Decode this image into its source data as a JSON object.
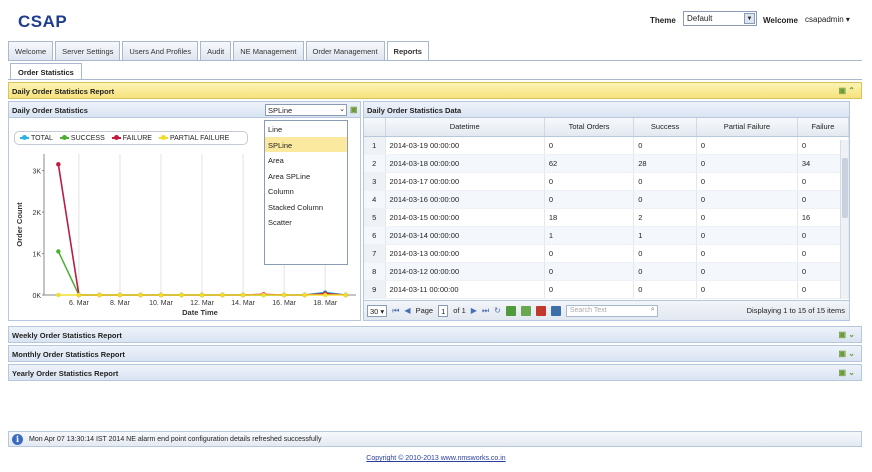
{
  "app": {
    "title": "CSAP"
  },
  "header": {
    "theme_label": "Theme",
    "theme_value": "Default",
    "welcome_label": "Welcome",
    "user": "csapadmin"
  },
  "tabs": [
    "Welcome",
    "Server Settings",
    "Users And Profiles",
    "Audit",
    "NE Management",
    "Order Management",
    "Reports"
  ],
  "active_tab": "Reports",
  "sub_tab": "Order Statistics",
  "sections": {
    "daily": "Daily Order Statistics Report",
    "weekly": "Weekly Order Statistics Report",
    "monthly": "Monthly Order Statistics Report",
    "yearly": "Yearly Order Statistics Report"
  },
  "chart_panel": {
    "title": "Daily Order Statistics",
    "chart_type_value": "SPLine",
    "chart_type_options": [
      "Line",
      "SPLine",
      "Area",
      "Area SPLine",
      "Column",
      "Stacked Column",
      "Scatter"
    ]
  },
  "chart_data": {
    "type": "line",
    "xlabel": "Date Time",
    "ylabel": "Order Count",
    "ylim": [
      0,
      3400
    ],
    "ytick_labels": [
      "0K",
      "1K",
      "2K",
      "3K"
    ],
    "yticks": [
      0,
      1000,
      2000,
      3000
    ],
    "x_tick_labels": [
      "6. Mar",
      "8. Mar",
      "10. Mar",
      "12. Mar",
      "14. Mar",
      "16. Mar",
      "18. Mar"
    ],
    "x_tick_days": [
      6,
      8,
      10,
      12,
      14,
      16,
      18
    ],
    "x_days": [
      5,
      6,
      7,
      8,
      9,
      10,
      11,
      12,
      13,
      14,
      15,
      16,
      17,
      18,
      19
    ],
    "xlim": [
      4.3,
      19.5
    ],
    "series": [
      {
        "name": "TOTAL",
        "color": "#2ab3e6",
        "values": [
          3150,
          0,
          0,
          0,
          0,
          0,
          0,
          0,
          0,
          0,
          0,
          0,
          0,
          62,
          0
        ]
      },
      {
        "name": "SUCCESS",
        "color": "#4caf34",
        "values": [
          1050,
          0,
          0,
          0,
          0,
          0,
          0,
          0,
          0,
          0,
          1,
          0,
          0,
          28,
          0
        ]
      },
      {
        "name": "FAILURE",
        "color": "#c8193c",
        "values": [
          3150,
          0,
          0,
          0,
          0,
          0,
          0,
          0,
          0,
          0,
          16,
          0,
          0,
          34,
          0
        ]
      },
      {
        "name": "PARTIAL FAILURE",
        "color": "#f2dd2b",
        "values": [
          0,
          0,
          0,
          0,
          0,
          0,
          0,
          0,
          0,
          0,
          0,
          0,
          0,
          0,
          0
        ]
      }
    ]
  },
  "data_panel": {
    "title": "Daily Order Statistics Data",
    "columns": [
      "Datetime",
      "Total Orders",
      "Success",
      "Partial Failure",
      "Failure"
    ],
    "rows": [
      [
        "1",
        "2014-03-19 00:00:00",
        "0",
        "0",
        "0",
        "0"
      ],
      [
        "2",
        "2014-03-18 00:00:00",
        "62",
        "28",
        "0",
        "34"
      ],
      [
        "3",
        "2014-03-17 00:00:00",
        "0",
        "0",
        "0",
        "0"
      ],
      [
        "4",
        "2014-03-16 00:00:00",
        "0",
        "0",
        "0",
        "0"
      ],
      [
        "5",
        "2014-03-15 00:00:00",
        "18",
        "2",
        "0",
        "16"
      ],
      [
        "6",
        "2014-03-14 00:00:00",
        "1",
        "1",
        "0",
        "0"
      ],
      [
        "7",
        "2014-03-13 00:00:00",
        "0",
        "0",
        "0",
        "0"
      ],
      [
        "8",
        "2014-03-12 00:00:00",
        "0",
        "0",
        "0",
        "0"
      ],
      [
        "9",
        "2014-03-11 00:00:00",
        "0",
        "0",
        "0",
        "0"
      ]
    ]
  },
  "pager": {
    "page_size": "30",
    "page_label": "Page",
    "page_value": "1",
    "of_label": "of 1",
    "search_placeholder": "Search Text",
    "info": "Displaying 1 to 15 of 15 items"
  },
  "status": {
    "message": "Mon Apr 07 13:30:14 IST 2014 NE alarm end point configuration details refreshed successfully"
  },
  "footer": {
    "copyright": "Copyright © 2010-2013 www.nmsworks.co.in"
  }
}
